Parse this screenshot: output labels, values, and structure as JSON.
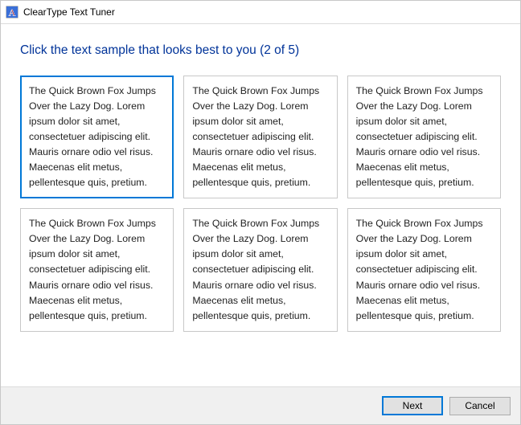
{
  "window": {
    "title": "ClearType Text Tuner"
  },
  "heading": "Click the text sample that looks best to you (2 of 5)",
  "sample_text": "The Quick Brown Fox Jumps Over the Lazy Dog. Lorem ipsum dolor sit amet, consectetuer adipiscing elit. Mauris ornare odio vel risus. Maecenas elit metus, pellentesque quis, pretium.",
  "samples": [
    {
      "selected": true
    },
    {
      "selected": false
    },
    {
      "selected": false
    },
    {
      "selected": false
    },
    {
      "selected": false
    },
    {
      "selected": false
    }
  ],
  "buttons": {
    "next": "Next",
    "cancel": "Cancel"
  },
  "colors": {
    "accent": "#0078d7",
    "heading": "#003399"
  }
}
